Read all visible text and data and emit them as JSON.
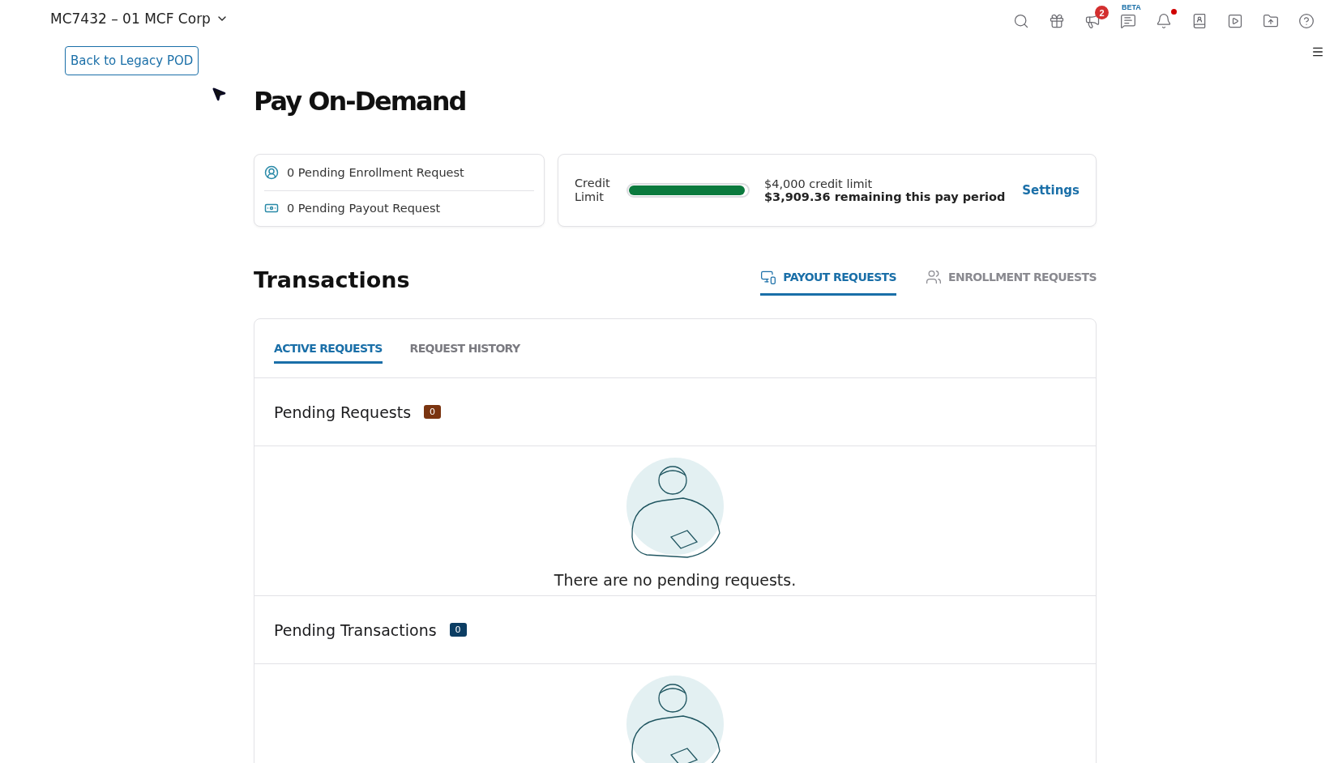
{
  "header": {
    "account": "MC7432 – 01 MCF Corp",
    "icons": [
      {
        "kind": "search"
      },
      {
        "kind": "gift"
      },
      {
        "kind": "megaphone",
        "badge": "2"
      },
      {
        "kind": "chat",
        "label": "BETA"
      },
      {
        "kind": "bell",
        "dot": true
      },
      {
        "kind": "contacts"
      },
      {
        "kind": "play"
      },
      {
        "kind": "folder-upload"
      },
      {
        "kind": "help"
      }
    ]
  },
  "back_button": "Back to Legacy POD",
  "title": "Pay On-Demand",
  "summary": [
    {
      "kind": "user",
      "text": "0 Pending Enrollment Request"
    },
    {
      "kind": "money",
      "text": "0 Pending Payout Request"
    }
  ],
  "credit": {
    "label": "Credit Limit",
    "level": 0.98,
    "limit": "$4,000 credit limit",
    "remaining": "$3,909.36 remaining this pay period",
    "link": "Settings"
  },
  "transactions": {
    "title": "Transactions",
    "tabs": [
      {
        "kind": "payout",
        "label": "PAYOUT REQUESTS",
        "selected": true
      },
      {
        "kind": "enrollment",
        "label": "ENROLLMENT REQUESTS",
        "selected": false
      }
    ],
    "subtabs": [
      {
        "label": "ACTIVE REQUESTS",
        "selected": true
      },
      {
        "label": "REQUEST HISTORY",
        "selected": false
      }
    ],
    "sections": [
      {
        "title": "Pending Requests",
        "count": "0",
        "color": "#7a3410",
        "message": "There are no pending requests."
      },
      {
        "title": "Pending Transactions",
        "count": "0",
        "color": "#0c3d63"
      }
    ]
  }
}
